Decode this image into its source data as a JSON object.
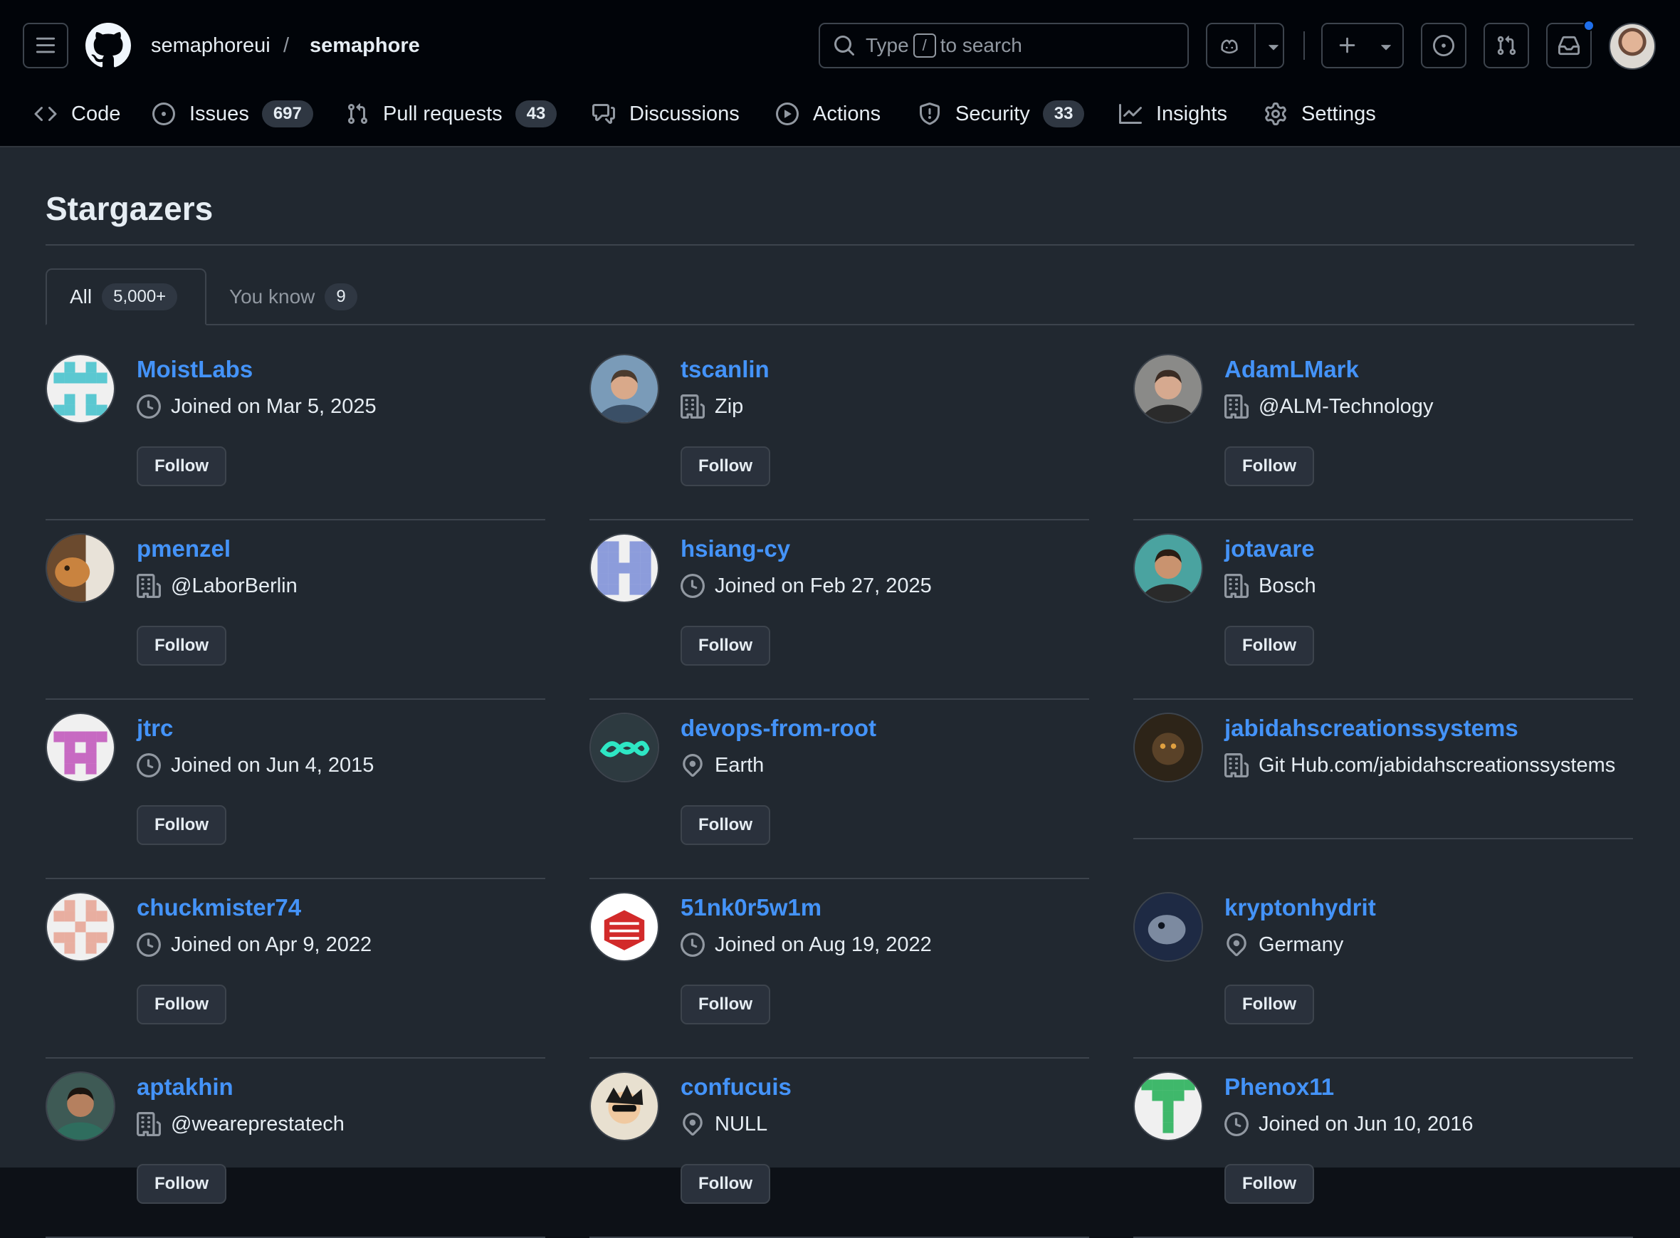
{
  "header": {
    "owner": "semaphoreui",
    "separator": "/",
    "repo": "semaphore",
    "search": {
      "prefix": "Type",
      "key": "/",
      "suffix": "to search"
    }
  },
  "icons": {
    "menu": "hamburger-icon",
    "logo": "github-mark-icon",
    "search": "search-icon",
    "copilot": "copilot-icon",
    "plus": "plus-icon",
    "issues": "issue-opened-icon",
    "pulls": "git-pull-request-icon",
    "inbox": "inbox-icon",
    "join": "clock-icon",
    "org": "organization-icon",
    "location": "location-icon"
  },
  "repo_tabs": [
    {
      "label": "Code",
      "icon": "code-icon",
      "count": ""
    },
    {
      "label": "Issues",
      "icon": "issue-opened-icon",
      "count": "697"
    },
    {
      "label": "Pull requests",
      "icon": "git-pull-request-icon",
      "count": "43"
    },
    {
      "label": "Discussions",
      "icon": "comment-discussion-icon",
      "count": ""
    },
    {
      "label": "Actions",
      "icon": "play-icon",
      "count": ""
    },
    {
      "label": "Security",
      "icon": "shield-icon",
      "count": "33"
    },
    {
      "label": "Insights",
      "icon": "graph-icon",
      "count": ""
    },
    {
      "label": "Settings",
      "icon": "gear-icon",
      "count": ""
    }
  ],
  "page": {
    "title": "Stargazers",
    "tabs": [
      {
        "label": "All",
        "count": "5,000+"
      },
      {
        "label": "You know",
        "count": "9"
      }
    ]
  },
  "stargazers": [
    {
      "username": "MoistLabs",
      "meta_icon": "clock-icon",
      "meta": "Joined on Mar 5, 2025",
      "button": "Follow"
    },
    {
      "username": "tscanlin",
      "meta_icon": "organization-icon",
      "meta": "Zip",
      "button": "Follow"
    },
    {
      "username": "AdamLMark",
      "meta_icon": "organization-icon",
      "meta": "@ALM-Technology",
      "button": "Follow"
    },
    {
      "username": "pmenzel",
      "meta_icon": "organization-icon",
      "meta": "@LaborBerlin",
      "button": "Follow"
    },
    {
      "username": "hsiang-cy",
      "meta_icon": "clock-icon",
      "meta": "Joined on Feb 27, 2025",
      "button": "Follow"
    },
    {
      "username": "jotavare",
      "meta_icon": "organization-icon",
      "meta": "Bosch",
      "button": "Follow"
    },
    {
      "username": "jtrc",
      "meta_icon": "clock-icon",
      "meta": "Joined on Jun 4, 2015",
      "button": "Follow"
    },
    {
      "username": "devops-from-root",
      "meta_icon": "location-icon",
      "meta": "Earth",
      "button": "Follow"
    },
    {
      "username": "jabidahscreationssystems",
      "meta_icon": "organization-icon",
      "meta": "Git Hub.com/jabidahscreationssystems",
      "button": ""
    },
    {
      "username": "chuckmister74",
      "meta_icon": "clock-icon",
      "meta": "Joined on Apr 9, 2022",
      "button": "Follow"
    },
    {
      "username": "51nk0r5w1m",
      "meta_icon": "clock-icon",
      "meta": "Joined on Aug 19, 2022",
      "button": "Follow"
    },
    {
      "username": "kryptonhydrit",
      "meta_icon": "location-icon",
      "meta": "Germany",
      "button": "Follow"
    },
    {
      "username": "aptakhin",
      "meta_icon": "organization-icon",
      "meta": "@weareprestatech",
      "button": "Follow"
    },
    {
      "username": "confucuis",
      "meta_icon": "location-icon",
      "meta": "NULL",
      "button": "Follow"
    },
    {
      "username": "Phenox11",
      "meta_icon": "clock-icon",
      "meta": "Joined on Jun 10, 2016",
      "button": "Follow"
    }
  ]
}
